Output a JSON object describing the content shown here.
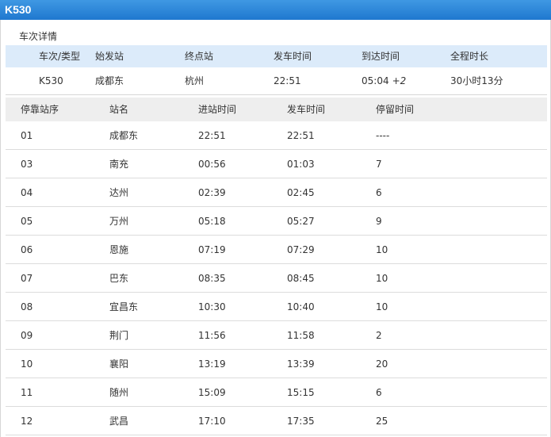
{
  "header": {
    "title": "K530"
  },
  "section_title": "车次详情",
  "summary": {
    "columns": [
      "车次/类型",
      "始发站",
      "终点站",
      "发车时间",
      "到达时间",
      "全程时长"
    ],
    "row": {
      "train": "K530",
      "from": "成都东",
      "to": "杭州",
      "depart": "22:51",
      "arrive": "05:04",
      "plus_day": "+2",
      "duration": "30小时13分"
    }
  },
  "stops": {
    "columns": [
      "停靠站序",
      "站名",
      "进站时间",
      "发车时间",
      "停留时间"
    ],
    "rows": [
      [
        "01",
        "成都东",
        "22:51",
        "22:51",
        "----"
      ],
      [
        "03",
        "南充",
        "00:56",
        "01:03",
        "7"
      ],
      [
        "04",
        "达州",
        "02:39",
        "02:45",
        "6"
      ],
      [
        "05",
        "万州",
        "05:18",
        "05:27",
        "9"
      ],
      [
        "06",
        "恩施",
        "07:19",
        "07:29",
        "10"
      ],
      [
        "07",
        "巴东",
        "08:35",
        "08:45",
        "10"
      ],
      [
        "08",
        "宜昌东",
        "10:30",
        "10:40",
        "10"
      ],
      [
        "09",
        "荆门",
        "11:56",
        "11:58",
        "2"
      ],
      [
        "10",
        "襄阳",
        "13:19",
        "13:39",
        "20"
      ],
      [
        "11",
        "随州",
        "15:09",
        "15:15",
        "6"
      ],
      [
        "12",
        "武昌",
        "17:10",
        "17:35",
        "25"
      ]
    ]
  },
  "colors": {
    "title_bar": "#2a86d8",
    "summary_header_bg": "#dcebfa",
    "stops_header_bg": "#eeeeee",
    "row_border": "#dcdcdc"
  }
}
